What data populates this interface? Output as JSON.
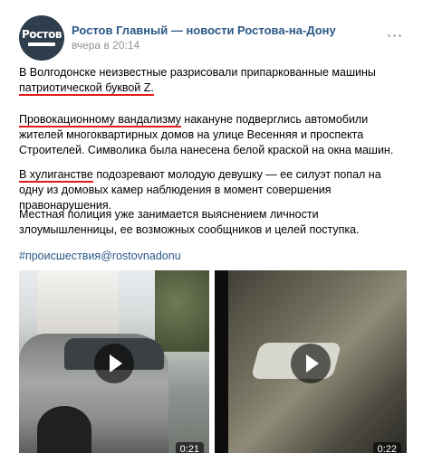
{
  "post": {
    "group_name": "Ростов Главный — новости Ростова-на-Дону",
    "time": "вчера в 20:14",
    "avatar_text": "Ростов",
    "paragraphs": {
      "p1_a": "В Волгодонске неизвестные разрисовали припаркованные машины",
      "p1_b": "патриотической буквой Z.",
      "p2_a": "Провокационному вандализму",
      "p2_b": " накануне подверглись автомобили жителей многоквартирных домов на улице Весенняя и проспекта Строителей. Символика была нанесена белой краской на окна машин.",
      "p3_a": "В хулиганстве",
      "p3_b": " подозревают молодую девушку — ее силуэт попал на одну из домовых камер наблюдения в момент совершения правонарушения.",
      "p4": "Местная полиция уже занимается выяснением личности злоумышленницы, ее возможных сообщников и целей поступка."
    },
    "hashtag": "#происшествия@rostovnadonu",
    "videos": [
      {
        "duration": "0:21"
      },
      {
        "duration": "0:22"
      }
    ]
  },
  "colors": {
    "link": "#2a5885",
    "meta": "#939393",
    "highlight": "#e31a1a"
  },
  "icons": {
    "more": "more-dots-icon",
    "play": "play-icon"
  }
}
